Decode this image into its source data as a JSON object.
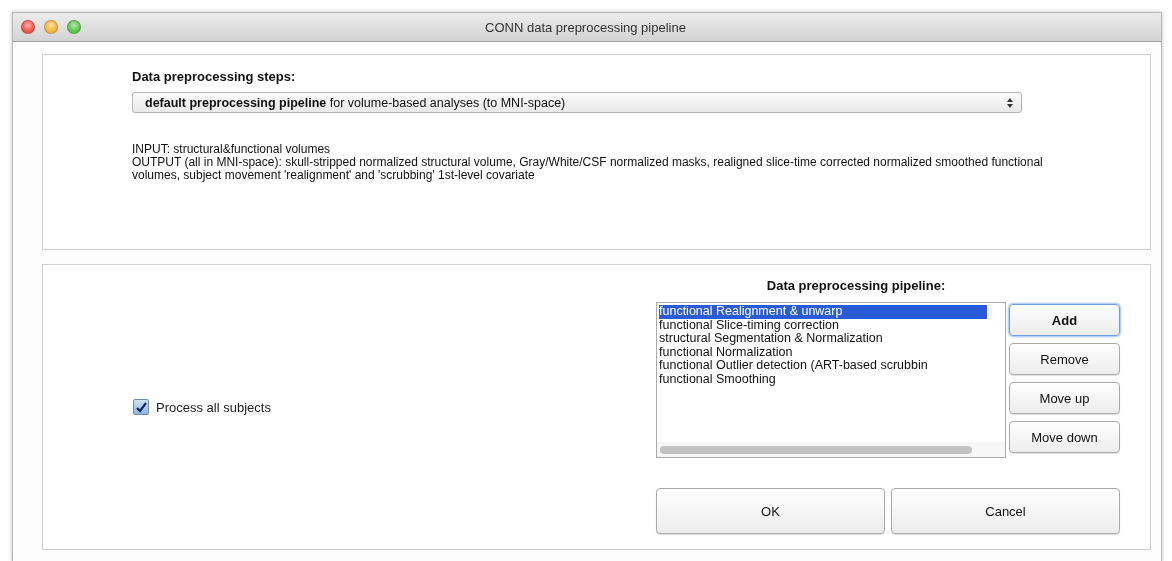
{
  "window": {
    "title": "CONN data preprocessing pipeline"
  },
  "steps": {
    "label": "Data preprocessing steps:",
    "dropdown": "**default preprocessing pipeline** for volume-based analyses (to MNI-space)",
    "description": [
      "INPUT: structural&functional volumes",
      "OUTPUT (all in MNI-space): skull-stripped normalized structural volume, Gray/White/CSF normalized masks, realigned slice-time corrected normalized smoothed functional volumes, subject movement 'realignment' and 'scrubbing' 1st-level covariate"
    ]
  },
  "process_all_subjects": {
    "label": "Process all subjects",
    "checked": true
  },
  "pipeline": {
    "label": "Data preprocessing pipeline:",
    "items": [
      {
        "label": "functional Realignment & unwarp",
        "selected": true
      },
      {
        "label": "functional Slice-timing correction",
        "selected": false
      },
      {
        "label": "structural Segmentation & Normalization",
        "selected": false
      },
      {
        "label": "functional Normalization",
        "selected": false
      },
      {
        "label": "functional Outlier detection (ART-based scrubbin",
        "selected": false
      },
      {
        "label": "functional Smoothing",
        "selected": false
      }
    ],
    "buttons": [
      {
        "label": "Add",
        "default": true
      },
      {
        "label": "Remove",
        "default": false
      },
      {
        "label": "Move up",
        "default": false
      },
      {
        "label": "Move down",
        "default": false
      }
    ]
  },
  "footer_buttons": [
    "OK",
    "Cancel"
  ]
}
